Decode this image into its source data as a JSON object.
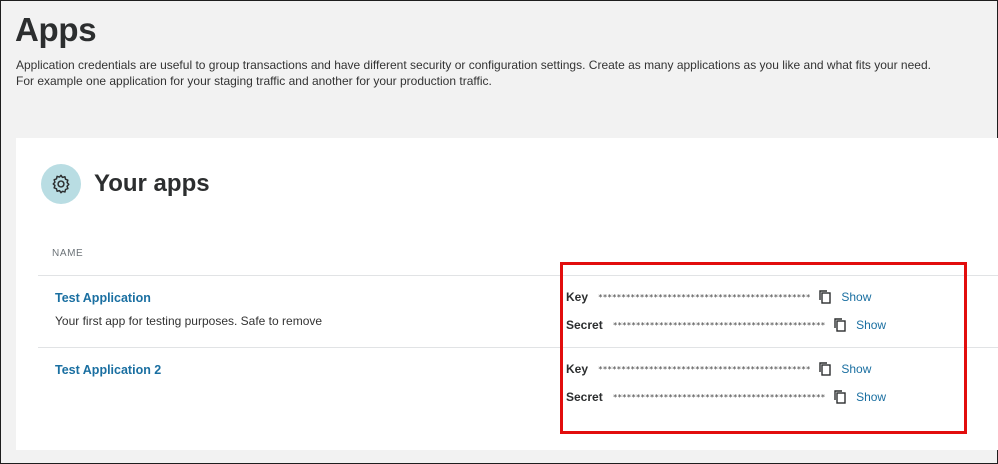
{
  "page": {
    "title": "Apps",
    "intro_line1": "Application credentials are useful to group transactions and have different security or configuration settings. Create as many applications as you like and what fits your need.",
    "intro_line2": "For example one application for your staging traffic and another for your production traffic."
  },
  "apps_card": {
    "title": "Your apps",
    "icon": "gear-icon",
    "column_header": "NAME",
    "apps": [
      {
        "name": "Test Application",
        "description": "Your first app for testing purposes. Safe to remove",
        "key_label": "Key",
        "key_value": "**********************************************",
        "secret_label": "Secret",
        "secret_value": "**********************************************",
        "copy_icon": "copy-icon",
        "show_label": "Show"
      },
      {
        "name": "Test Application 2",
        "description": "",
        "key_label": "Key",
        "key_value": "**********************************************",
        "secret_label": "Secret",
        "secret_value": "**********************************************",
        "copy_icon": "copy-icon",
        "show_label": "Show"
      }
    ]
  },
  "colors": {
    "link": "#1a6fa1",
    "icon_circle": "#b9dde3",
    "highlight_border": "#e20d0d",
    "page_bg": "#f2f2f2"
  }
}
